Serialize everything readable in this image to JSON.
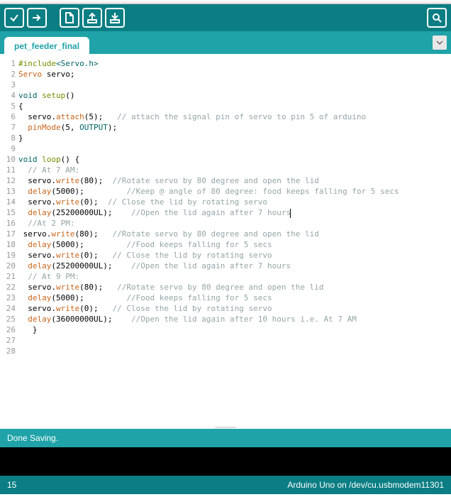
{
  "tab": {
    "name": "pet_feeder_final"
  },
  "status": {
    "message": "Done Saving."
  },
  "footer": {
    "line_no": "15",
    "board_port": "Arduino Uno on /dev/cu.usbmodem11301"
  },
  "code": {
    "lines": [
      {
        "n": 1,
        "tokens": [
          [
            "c-pp",
            "#include"
          ],
          [
            "c-ang",
            "<Servo.h>"
          ]
        ]
      },
      {
        "n": 2,
        "tokens": [
          [
            "c-typ",
            "Servo"
          ],
          [
            "c-id",
            " servo;"
          ]
        ]
      },
      {
        "n": 3,
        "tokens": []
      },
      {
        "n": 4,
        "tokens": [
          [
            "c-kw",
            "void"
          ],
          [
            "c-id",
            " "
          ],
          [
            "c-setup",
            "setup"
          ],
          [
            "c-id",
            "()"
          ]
        ]
      },
      {
        "n": 5,
        "tokens": [
          [
            "c-id",
            "{"
          ]
        ]
      },
      {
        "n": 6,
        "tokens": [
          [
            "c-id",
            "  servo."
          ],
          [
            "c-fn",
            "attach"
          ],
          [
            "c-id",
            "(5);   "
          ],
          [
            "c-cmt",
            "// attach the signal pin of servo to pin 5 of arduino"
          ]
        ]
      },
      {
        "n": 7,
        "tokens": [
          [
            "c-id",
            "  "
          ],
          [
            "c-fn",
            "pinMode"
          ],
          [
            "c-id",
            "(5, "
          ],
          [
            "c-kw",
            "OUTPUT"
          ],
          [
            "c-id",
            ");"
          ]
        ]
      },
      {
        "n": 8,
        "tokens": [
          [
            "c-id",
            "}"
          ]
        ]
      },
      {
        "n": 9,
        "tokens": []
      },
      {
        "n": 10,
        "tokens": [
          [
            "c-kw",
            "void"
          ],
          [
            "c-id",
            " "
          ],
          [
            "c-setup",
            "loop"
          ],
          [
            "c-id",
            "() {"
          ]
        ]
      },
      {
        "n": 11,
        "tokens": [
          [
            "c-id",
            "  "
          ],
          [
            "c-cmt",
            "// At 7 AM:"
          ]
        ]
      },
      {
        "n": 12,
        "tokens": [
          [
            "c-id",
            "  servo."
          ],
          [
            "c-fn",
            "write"
          ],
          [
            "c-id",
            "(80);  "
          ],
          [
            "c-cmt",
            "//Rotate servo by 80 degree and open the lid"
          ]
        ]
      },
      {
        "n": 13,
        "tokens": [
          [
            "c-id",
            "  "
          ],
          [
            "c-fn",
            "delay"
          ],
          [
            "c-id",
            "(5000);         "
          ],
          [
            "c-cmt",
            "//Keep @ angle of 80 degree: food keeps falling for 5 secs"
          ]
        ]
      },
      {
        "n": 14,
        "tokens": [
          [
            "c-id",
            "  servo."
          ],
          [
            "c-fn",
            "write"
          ],
          [
            "c-id",
            "(0);  "
          ],
          [
            "c-cmt",
            "// Close the lid by rotating servo"
          ]
        ]
      },
      {
        "n": 15,
        "tokens": [
          [
            "c-id",
            "  "
          ],
          [
            "c-fn",
            "delay"
          ],
          [
            "c-id",
            "(25200000UL);    "
          ],
          [
            "c-cmt",
            "//Open the lid again after 7 hours"
          ],
          [
            "cursor",
            ""
          ]
        ]
      },
      {
        "n": 16,
        "tokens": [
          [
            "c-id",
            "  "
          ],
          [
            "c-cmt",
            "//At 2 PM:"
          ]
        ]
      },
      {
        "n": 17,
        "tokens": [
          [
            "c-id",
            " servo."
          ],
          [
            "c-fn",
            "write"
          ],
          [
            "c-id",
            "(80);   "
          ],
          [
            "c-cmt",
            "//Rotate servo by 80 degree and open the lid"
          ]
        ]
      },
      {
        "n": 18,
        "tokens": [
          [
            "c-id",
            "  "
          ],
          [
            "c-fn",
            "delay"
          ],
          [
            "c-id",
            "(5000);         "
          ],
          [
            "c-cmt",
            "//Food keeps falling for 5 secs"
          ]
        ]
      },
      {
        "n": 19,
        "tokens": [
          [
            "c-id",
            "  servo."
          ],
          [
            "c-fn",
            "write"
          ],
          [
            "c-id",
            "(0);   "
          ],
          [
            "c-cmt",
            "// Close the lid by rotating servo"
          ]
        ]
      },
      {
        "n": 20,
        "tokens": [
          [
            "c-id",
            "  "
          ],
          [
            "c-fn",
            "delay"
          ],
          [
            "c-id",
            "(25200000UL);    "
          ],
          [
            "c-cmt",
            "//Open the lid again after 7 hours"
          ]
        ]
      },
      {
        "n": 21,
        "tokens": [
          [
            "c-id",
            "  "
          ],
          [
            "c-cmt",
            "// At 9 PM:"
          ]
        ]
      },
      {
        "n": 22,
        "tokens": [
          [
            "c-id",
            "  servo."
          ],
          [
            "c-fn",
            "write"
          ],
          [
            "c-id",
            "(80);   "
          ],
          [
            "c-cmt",
            "//Rotate servo by 80 degree and open the lid"
          ]
        ]
      },
      {
        "n": 23,
        "tokens": [
          [
            "c-id",
            "  "
          ],
          [
            "c-fn",
            "delay"
          ],
          [
            "c-id",
            "(5000);         "
          ],
          [
            "c-cmt",
            "//Food keeps falling for 5 secs"
          ]
        ]
      },
      {
        "n": 24,
        "tokens": [
          [
            "c-id",
            "  servo."
          ],
          [
            "c-fn",
            "write"
          ],
          [
            "c-id",
            "(0);   "
          ],
          [
            "c-cmt",
            "// Close the lid by rotating servo"
          ]
        ]
      },
      {
        "n": 25,
        "tokens": [
          [
            "c-id",
            "  "
          ],
          [
            "c-fn",
            "delay"
          ],
          [
            "c-id",
            "(36000000UL);    "
          ],
          [
            "c-cmt",
            "//Open the lid again after 10 hours i.e. At 7 AM"
          ]
        ]
      },
      {
        "n": 26,
        "tokens": [
          [
            "c-id",
            "   }"
          ]
        ]
      },
      {
        "n": 27,
        "tokens": []
      },
      {
        "n": 28,
        "tokens": []
      }
    ]
  }
}
